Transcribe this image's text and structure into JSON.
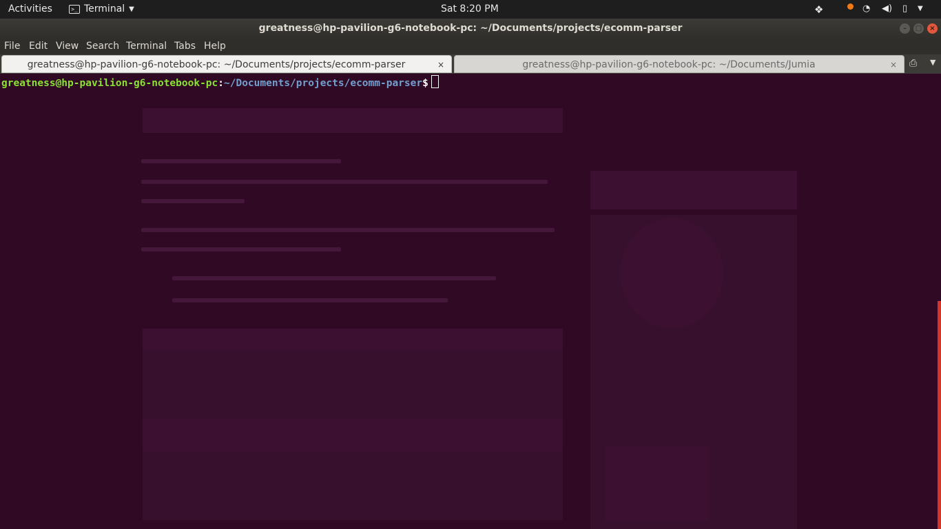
{
  "topbar": {
    "activities": "Activities",
    "app_menu": "Terminal",
    "clock": "Sat  8:20 PM",
    "tray_icons": [
      "dropbox-icon",
      "notification-dot-icon",
      "wifi-icon",
      "volume-icon",
      "battery-icon",
      "power-menu-icon"
    ]
  },
  "window": {
    "title": "greatness@hp-pavilion-g6-notebook-pc: ~/Documents/projects/ecomm-parser",
    "buttons": [
      "minimize",
      "maximize",
      "close"
    ]
  },
  "menubar": {
    "items": [
      "File",
      "Edit",
      "View",
      "Search",
      "Terminal",
      "Tabs",
      "Help"
    ]
  },
  "tabs": [
    {
      "label": "greatness@hp-pavilion-g6-notebook-pc: ~/Documents/projects/ecomm-parser",
      "active": true
    },
    {
      "label": "greatness@hp-pavilion-g6-notebook-pc: ~/Documents/Jumia",
      "active": false
    }
  ],
  "terminal": {
    "prompt_user": "greatness@hp-pavilion-g6-notebook-pc",
    "prompt_colon": ":",
    "prompt_path": "~/Documents/projects/ecomm-parser",
    "prompt_symbol": "$"
  },
  "colors": {
    "terminal_bg": "#300a24",
    "prompt_user": "#8ae234",
    "prompt_path": "#729fcf",
    "close_button": "#e2583e"
  }
}
